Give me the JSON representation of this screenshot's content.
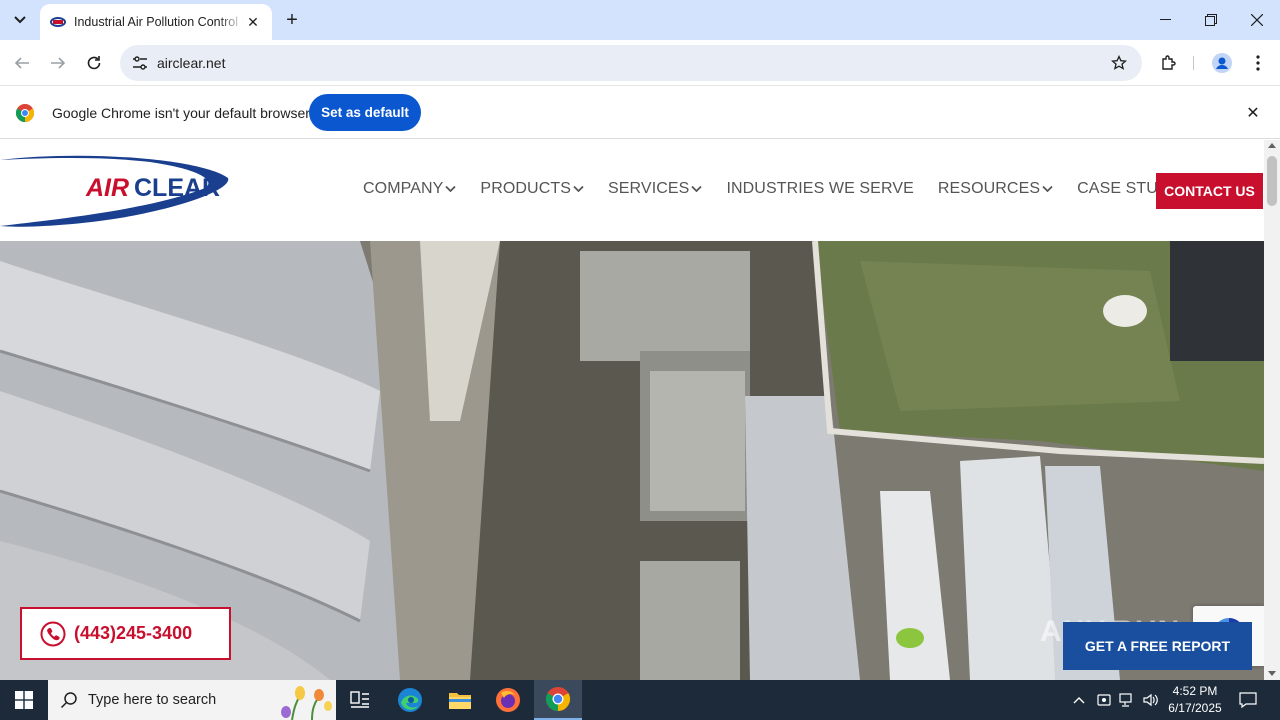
{
  "browser": {
    "tab_title": "Industrial Air Pollution Control Systems",
    "new_tab_label": "+",
    "url": "airclear.net"
  },
  "infobar": {
    "message": "Google Chrome isn't your default browser",
    "button_label": "Set as default"
  },
  "site": {
    "logo_text_left": "AIR",
    "logo_text_right": "CLEAR",
    "nav": [
      {
        "label": "COMPANY",
        "dropdown": true
      },
      {
        "label": "PRODUCTS",
        "dropdown": true
      },
      {
        "label": "SERVICES",
        "dropdown": true
      },
      {
        "label": "INDUSTRIES WE SERVE",
        "dropdown": false
      },
      {
        "label": "RESOURCES",
        "dropdown": true
      },
      {
        "label": "CASE STUDIES",
        "dropdown": false
      }
    ],
    "contact_label": "CONTACT US",
    "phone": "(443)245-3400",
    "free_report_label": "GET A FREE REPORT",
    "watermark": "ANY.RUN",
    "brand_red": "#c8102e",
    "brand_blue": "#1a4fa0"
  },
  "taskbar": {
    "search_placeholder": "Type here to search",
    "time": "4:52 PM",
    "date": "6/17/2025"
  }
}
